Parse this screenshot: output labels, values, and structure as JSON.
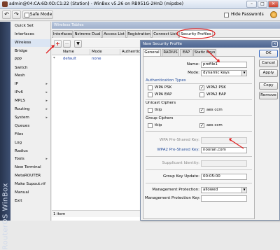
{
  "window": {
    "title": "admin@04:CA:6D:0D:C1:22 (Station) - WinBox v5.26 on RB951G-2HnD (mipsbe)",
    "controls": [
      "–",
      "□",
      "✕"
    ]
  },
  "toolbar": {
    "undo_icon": "undo-icon",
    "redo_icon": "redo-icon",
    "safe_mode_label": "Safe Mode",
    "hide_passwords_label": "Hide Passwords"
  },
  "brand": {
    "text": "RouterOS WinBox"
  },
  "menu": {
    "items": [
      {
        "label": "Quick Set",
        "arrow": false
      },
      {
        "label": "Interfaces",
        "arrow": false
      },
      {
        "label": "Wireless",
        "arrow": false
      },
      {
        "label": "Bridge",
        "arrow": false
      },
      {
        "label": "PPP",
        "arrow": false
      },
      {
        "label": "Switch",
        "arrow": false
      },
      {
        "label": "Mesh",
        "arrow": false
      },
      {
        "label": "IP",
        "arrow": true
      },
      {
        "label": "IPv6",
        "arrow": true
      },
      {
        "label": "MPLS",
        "arrow": true
      },
      {
        "label": "Routing",
        "arrow": true
      },
      {
        "label": "System",
        "arrow": true
      },
      {
        "label": "Queues",
        "arrow": false
      },
      {
        "label": "Files",
        "arrow": false
      },
      {
        "label": "Log",
        "arrow": false
      },
      {
        "label": "Radius",
        "arrow": false
      },
      {
        "label": "Tools",
        "arrow": true
      },
      {
        "label": "New Terminal",
        "arrow": false
      },
      {
        "label": "MetaROUTER",
        "arrow": false
      },
      {
        "label": "Make Supout.rif",
        "arrow": false
      },
      {
        "label": "Manual",
        "arrow": false
      },
      {
        "label": "Exit",
        "arrow": false
      }
    ],
    "arrow_glyph": "▸"
  },
  "wireless_tables": {
    "title": "Wireless Tables",
    "tabs": [
      "Interfaces",
      "Nstreme Dual",
      "Access List",
      "Registration",
      "Connect List",
      "Security Profiles"
    ],
    "add_glyph": "+",
    "remove_glyph": "−",
    "filter_glyph": "▼",
    "columns": [
      "Name",
      "Mode",
      "Authenticat"
    ],
    "rows": [
      {
        "marker": "*",
        "name": "default",
        "mode": "none"
      }
    ],
    "status": "1 item"
  },
  "dialog": {
    "title": "New Security Profile",
    "close_glyph": "✕",
    "tabs": [
      "General",
      "RADIUS",
      "EAP",
      "Static Keys"
    ],
    "name_label": "Name:",
    "name_value": "profile1",
    "mode_label": "Mode:",
    "mode_value": "dynamic keys",
    "auth_types_title": "Authentication Types",
    "auth_types": [
      {
        "label": "WPA PSK",
        "checked": false
      },
      {
        "label": "WPA2 PSK",
        "checked": true
      },
      {
        "label": "WPA EAP",
        "checked": false
      },
      {
        "label": "WPA2 EAP",
        "checked": false
      }
    ],
    "unicast_title": "Unicast Ciphers",
    "unicast": [
      {
        "label": "tkip",
        "checked": false
      },
      {
        "label": "aes ccm",
        "checked": true
      }
    ],
    "group_title": "Group Ciphers",
    "group": [
      {
        "label": "tkip",
        "checked": false
      },
      {
        "label": "aes ccm",
        "checked": true
      }
    ],
    "wpa_key_label": "WPA Pre-Shared Key:",
    "wpa_key_value": "",
    "wpa2_key_label": "WPA2 Pre-Shared Key:",
    "wpa2_key_value": "nooran.com",
    "supplicant_label": "Supplicant Identity:",
    "supplicant_value": "",
    "group_key_label": "Group Key Update:",
    "group_key_value": "00:05:00",
    "mgmt_protection_label": "Management Protection:",
    "mgmt_protection_value": "allowed",
    "mgmt_key_label": "Management Protection Key:",
    "mgmt_key_value": "",
    "check_glyph": "✓",
    "dropdown_glyph": "▼",
    "buttons": [
      "OK",
      "Cancel",
      "Apply",
      "Copy",
      "Remove"
    ]
  },
  "colors": {
    "annotation": "#e02020",
    "group_title": "#274f9d",
    "dialog_title": "#4d6590"
  }
}
